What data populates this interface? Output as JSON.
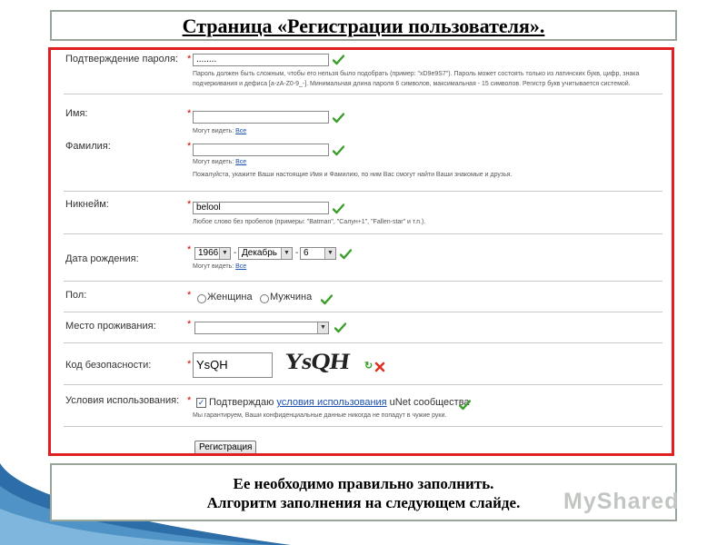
{
  "slide": {
    "title": "Страница «Регистрации пользователя».",
    "bottom_line1": "Ее необходимо правильно заполнить.",
    "bottom_line2": "Алгоритм заполнения на следующем слайде.",
    "watermark": "MyShared"
  },
  "form": {
    "required_mark": "*",
    "password_confirm": {
      "label": "Подтверждение пароля:",
      "value": "........",
      "hint_line1": "Пароль должен быть сложным, чтобы его нельзя было подобрать (пример: \"xD9e9S7\"). Пароль может состоять только из латинских букв, цифр, знака",
      "hint_line2": "подчеркивания и дефиса [a-zA-Z0-9_-]. Минимальная длина пароля 6 символов, максимальная - 15 символов. Регистр букв учитывается системой."
    },
    "first_name": {
      "label": "Имя:",
      "value": "",
      "visibility_text": "Могут видеть:",
      "visibility_link": "Все"
    },
    "last_name": {
      "label": "Фамилия:",
      "value": "",
      "visibility_text": "Могут видеть:",
      "visibility_link": "Все",
      "hint": "Пожалуйста, укажите Ваши настоящие Имя и Фамилию, по ним Вас смогут найти Ваши знакомые и друзья."
    },
    "nickname": {
      "label": "Никнейм:",
      "value": "belool",
      "hint": "Любое слово без пробелов (примеры: \"Batman\", \"Салун+1\", \"Fallen-star\" и т.п.)."
    },
    "birth_date": {
      "label": "Дата рождения:",
      "year": "1966",
      "month": "Декабрь",
      "day": "6",
      "separator": "-",
      "visibility_text": "Могут видеть:",
      "visibility_link": "Все"
    },
    "gender": {
      "label": "Пол:",
      "option_female": "Женщина",
      "option_male": "Мужчина"
    },
    "residence": {
      "label": "Место проживания:",
      "value": ""
    },
    "security_code": {
      "label": "Код безопасности:",
      "value": "YsQH",
      "captcha_text": "YsQH"
    },
    "terms": {
      "label": "Условия использования:",
      "text_before": "Подтверждаю ",
      "link": "условия использования",
      "text_after": " uNet сообщества",
      "checked_mark": "✓",
      "note": "Мы гарантируем, Ваши конфиденциальные данные никогда не попадут в чужие руки."
    },
    "submit_label": "Регистрация"
  },
  "colors": {
    "frame_border": "#e02020",
    "box_border": "#9aa59a",
    "check_green": "#3aa02a",
    "error_red": "#e03020",
    "link_blue": "#1a4fb0"
  }
}
